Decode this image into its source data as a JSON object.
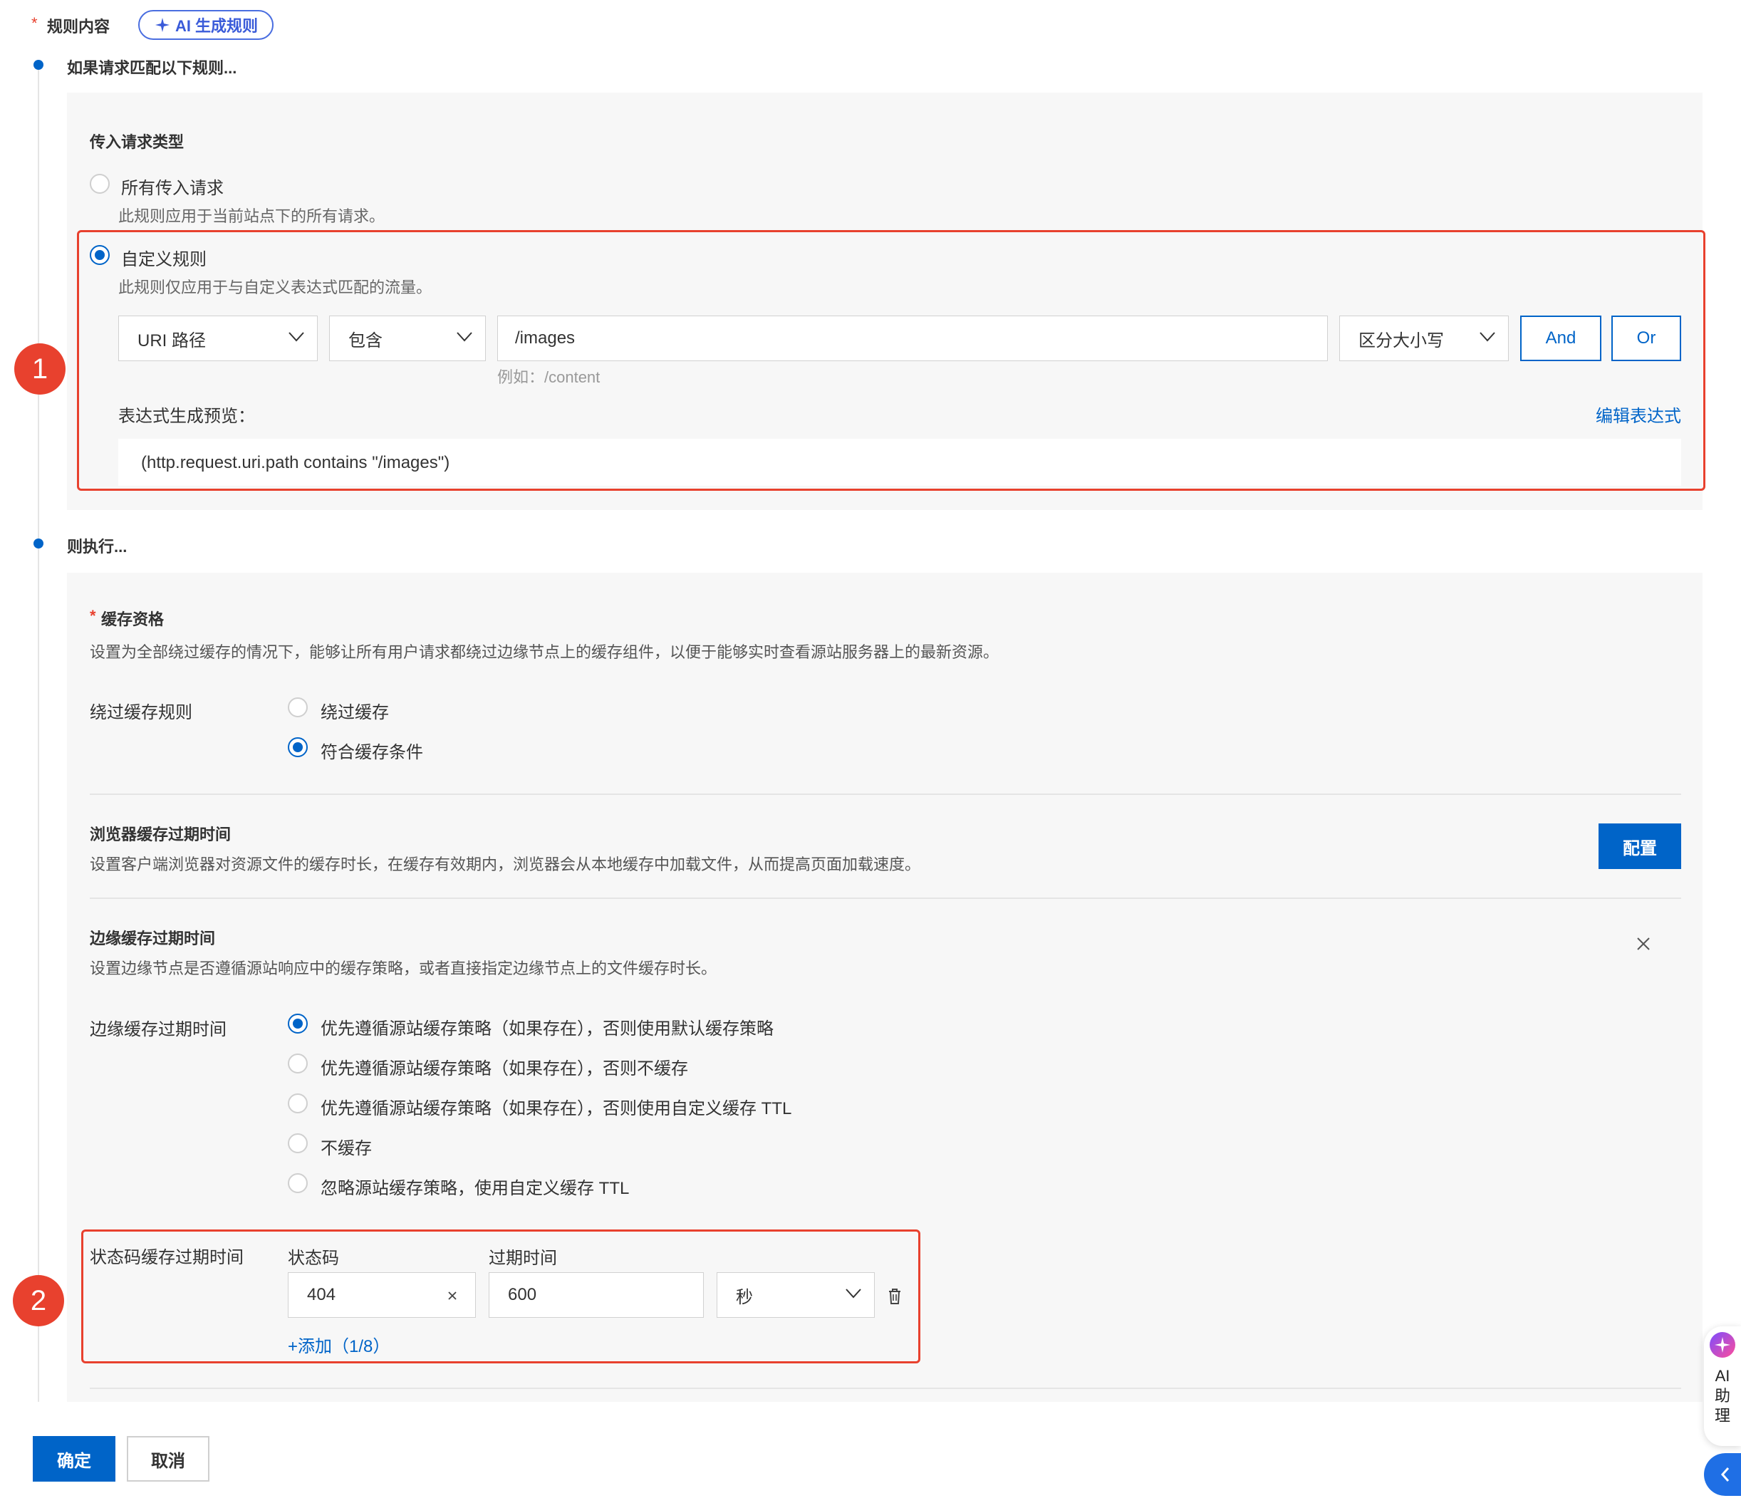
{
  "header": {
    "required_mark": "*",
    "title": "规则内容",
    "ai_button": "AI 生成规则",
    "ai_icon": "sparkle-icon"
  },
  "if_section": {
    "title": "如果请求匹配以下规则...",
    "incoming_type_title": "传入请求类型",
    "options": [
      {
        "label": "所有传入请求",
        "desc": "此规则应用于当前站点下的所有请求。",
        "checked": false
      },
      {
        "label": "自定义规则",
        "desc": "此规则仅应用于与自定义表达式匹配的流量。",
        "checked": true
      }
    ],
    "condition": {
      "field": "URI 路径",
      "operator": "包含",
      "value": "/images",
      "value_hint": "例如：/content",
      "case": "区分大小写",
      "and_label": "And",
      "or_label": "Or"
    },
    "preview_label": "表达式生成预览：",
    "edit_expression": "编辑表达式",
    "expression": "(http.request.uri.path contains \"/images\")"
  },
  "then_section": {
    "title": "则执行...",
    "cache_eligibility": {
      "required_mark": "*",
      "title": "缓存资格",
      "desc": "设置为全部绕过缓存的情况下，能够让所有用户请求都绕过边缘节点上的缓存组件，以便于能够实时查看源站服务器上的最新资源。",
      "rule_label": "绕过缓存规则",
      "options": [
        {
          "label": "绕过缓存",
          "checked": false
        },
        {
          "label": "符合缓存条件",
          "checked": true
        }
      ]
    },
    "browser_cache": {
      "title": "浏览器缓存过期时间",
      "desc": "设置客户端浏览器对资源文件的缓存时长，在缓存有效期内，浏览器会从本地缓存中加载文件，从而提高页面加载速度。",
      "config_button": "配置"
    },
    "edge_cache": {
      "title": "边缘缓存过期时间",
      "desc": "设置边缘节点是否遵循源站响应中的缓存策略，或者直接指定边缘节点上的文件缓存时长。",
      "rule_label": "边缘缓存过期时间",
      "options": [
        {
          "label": "优先遵循源站缓存策略（如果存在），否则使用默认缓存策略",
          "checked": true
        },
        {
          "label": "优先遵循源站缓存策略（如果存在），否则不缓存",
          "checked": false
        },
        {
          "label": "优先遵循源站缓存策略（如果存在），否则使用自定义缓存 TTL",
          "checked": false
        },
        {
          "label": "不缓存",
          "checked": false
        },
        {
          "label": "忽略源站缓存策略，使用自定义缓存 TTL",
          "checked": false
        }
      ]
    },
    "status_code_cache": {
      "label": "状态码缓存过期时间",
      "code_header": "状态码",
      "ttl_header": "过期时间",
      "code_value": "404",
      "ttl_value": "600",
      "unit": "秒",
      "add_label": "+添加（1/8）"
    }
  },
  "annotations": {
    "badge1": "1",
    "badge2": "2"
  },
  "footer": {
    "confirm": "确定",
    "cancel": "取消"
  },
  "assistant": {
    "label_line1": "AI",
    "label_line2": "助",
    "label_line3": "理"
  },
  "colors": {
    "primary": "#0064c8",
    "annotation_red": "#e8412e",
    "panel_bg": "#f7f7f7"
  }
}
